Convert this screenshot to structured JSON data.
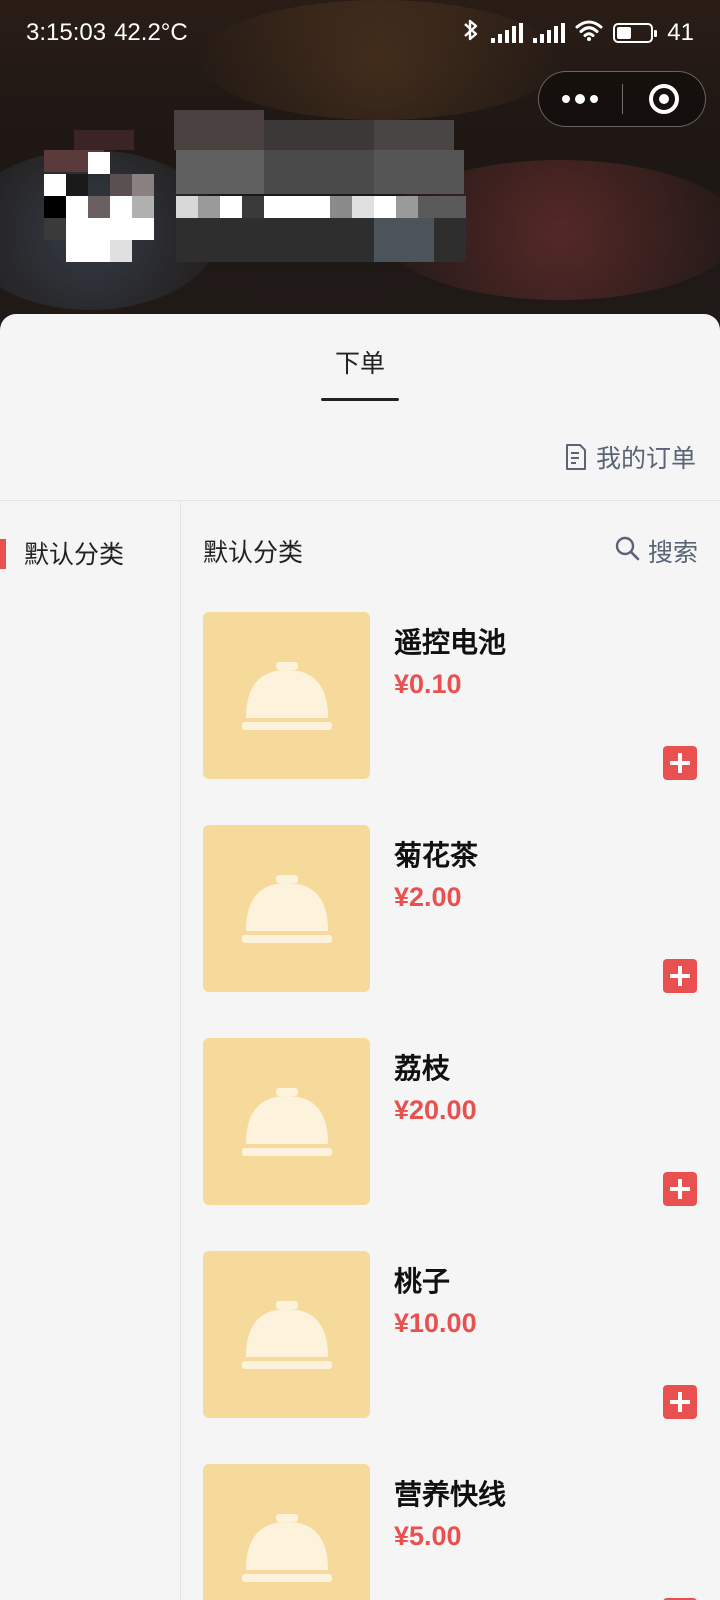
{
  "status_bar": {
    "time": "3:15:03",
    "temperature": "42.2°C",
    "battery": "41"
  },
  "icons": {
    "bluetooth": "bluetooth-icon",
    "signal": "signal-icon",
    "wifi": "wifi-icon",
    "battery": "battery-icon",
    "more": "more-dots-icon",
    "close": "target-close-icon",
    "orders": "document-icon",
    "search": "search-icon",
    "product_placeholder": "service-bell-icon",
    "add": "plus-icon"
  },
  "tabs": [
    {
      "label": "下单",
      "active": true
    }
  ],
  "orders_link": {
    "label": "我的订单"
  },
  "sidebar": {
    "categories": [
      {
        "label": "默认分类",
        "active": true
      }
    ]
  },
  "content": {
    "category_title": "默认分类",
    "search_label": "搜索",
    "products": [
      {
        "name": "遥控电池",
        "price": "¥0.10"
      },
      {
        "name": "菊花茶",
        "price": "¥2.00"
      },
      {
        "name": "荔枝",
        "price": "¥20.00"
      },
      {
        "name": "桃子",
        "price": "¥10.00"
      },
      {
        "name": "营养快线",
        "price": "¥5.00"
      }
    ]
  },
  "colors": {
    "accent": "#e95151",
    "placeholder_bg": "#f5da9c",
    "link": "#5a6476"
  }
}
